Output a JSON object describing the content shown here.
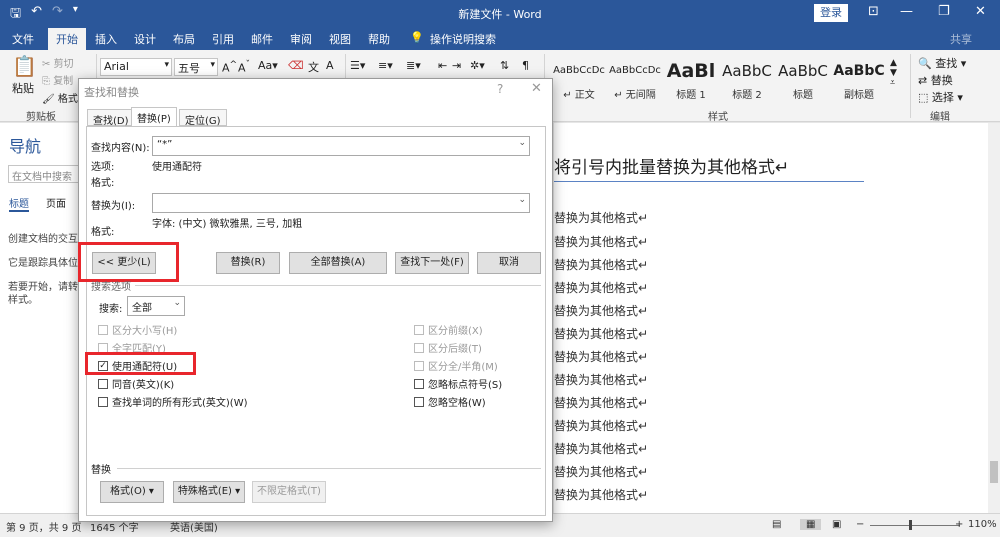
{
  "window": {
    "doc_title": "新建文件 - Word",
    "login_label": "登录",
    "share_label": "共享"
  },
  "ribbon_tabs": [
    "文件",
    "开始",
    "插入",
    "设计",
    "布局",
    "引用",
    "邮件",
    "审阅",
    "视图",
    "帮助",
    "操作说明搜索"
  ],
  "clipboard": {
    "paste": "粘贴",
    "cut": "剪切",
    "copy": "复制",
    "format_painter": "格式",
    "group_label": "剪贴板"
  },
  "font": {
    "name": "Arial",
    "size": "五号"
  },
  "styles": {
    "group_label": "样式",
    "items": [
      {
        "preview": "AaBbCcDc",
        "name": "正文"
      },
      {
        "preview": "AaBbCcDc",
        "name": "无间隔"
      },
      {
        "preview": "AaBl",
        "name": "标题 1"
      },
      {
        "preview": "AaBbC",
        "name": "标题 2"
      },
      {
        "preview": "AaBbC",
        "name": "标题"
      },
      {
        "preview": "AaBbC",
        "name": "副标题"
      }
    ]
  },
  "editing": {
    "find": "查找",
    "replace": "替换",
    "select": "选择",
    "group_label": "编辑"
  },
  "nav": {
    "title": "导航",
    "search_placeholder": "在文档中搜索",
    "tab_headings": "标题",
    "tab_pages": "页面",
    "text1": "创建文档的交互",
    "text2": "它是跟踪具体位",
    "text3": "若要开始，请转",
    "text4": "样式。"
  },
  "document": {
    "heading": "将引号内批量替换为其他格式↵",
    "lines": [
      "替换为其他格式↵",
      "替换为其他格式↵",
      "替换为其他格式↵",
      "替换为其他格式↵",
      "替换为其他格式↵",
      "替换为其他格式↵",
      "替换为其他格式↵",
      "替换为其他格式↵",
      "替换为其他格式↵",
      "替换为其他格式↵",
      "替换为其他格式↵",
      "替换为其他格式↵",
      "替换为其他格式↵"
    ]
  },
  "status": {
    "page": "第 9 页，共 9 页",
    "words": "1645 个字",
    "language": "英语(美国)",
    "zoom": "110%"
  },
  "dialog": {
    "title": "查找和替换",
    "help": "?",
    "close": "✕",
    "tabs": [
      "查找(D)",
      "替换(P)",
      "定位(G)"
    ],
    "find_label": "查找内容(N):",
    "find_value": "“*”",
    "options_label": "选项:",
    "options_value": "使用通配符",
    "format_label": "格式:",
    "replace_label": "替换为(I):",
    "replace_value": "",
    "replace_format_label": "格式:",
    "replace_format_value": "字体: (中文) 微软雅黑, 三号, 加粗",
    "less_button": "<< 更少(L)",
    "replace_button": "替换(R)",
    "replace_all_button": "全部替换(A)",
    "find_next_button": "查找下一处(F)",
    "cancel_button": "取消",
    "search_options_label": "搜索选项",
    "search_label": "搜索:",
    "search_value": "全部",
    "options_left": [
      {
        "label": "区分大小写(H)",
        "checked": false,
        "enabled": false
      },
      {
        "label": "全字匹配(Y)",
        "checked": false,
        "enabled": false
      },
      {
        "label": "使用通配符(U)",
        "checked": true,
        "enabled": true
      },
      {
        "label": "同音(英文)(K)",
        "checked": false,
        "enabled": true
      },
      {
        "label": "查找单词的所有形式(英文)(W)",
        "checked": false,
        "enabled": true
      }
    ],
    "options_right": [
      {
        "label": "区分前缀(X)",
        "checked": false,
        "enabled": false
      },
      {
        "label": "区分后缀(T)",
        "checked": false,
        "enabled": false
      },
      {
        "label": "区分全/半角(M)",
        "checked": false,
        "enabled": false
      },
      {
        "label": "忽略标点符号(S)",
        "checked": false,
        "enabled": true
      },
      {
        "label": "忽略空格(W)",
        "checked": false,
        "enabled": true
      }
    ],
    "replace_section_label": "替换",
    "format_button": "格式(O) ▾",
    "special_button": "特殊格式(E) ▾",
    "no_format_button": "不限定格式(T)"
  },
  "colors": {
    "accent": "#2b579a",
    "highlight": "#e8262c"
  }
}
